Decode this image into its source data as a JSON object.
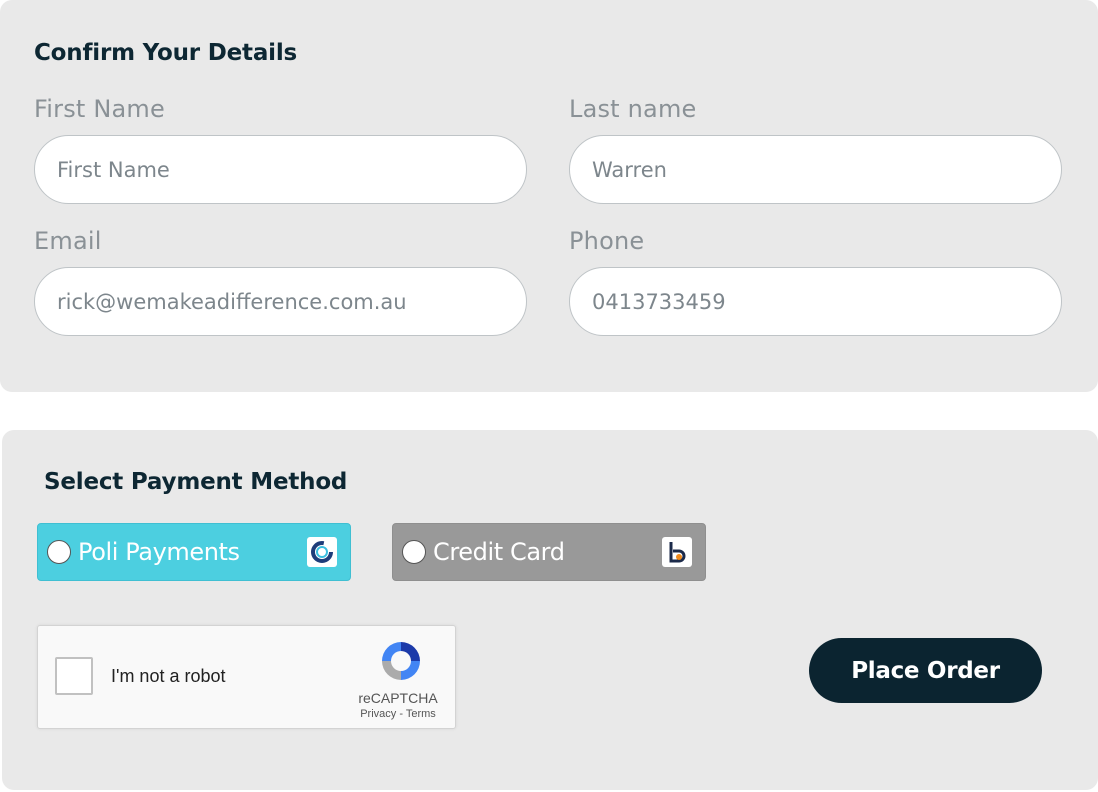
{
  "details": {
    "title": "Confirm Your Details",
    "first_name": {
      "label": "First Name",
      "placeholder": "First Name",
      "value": ""
    },
    "last_name": {
      "label": "Last name",
      "value": "Warren"
    },
    "email": {
      "label": "Email",
      "value": "rick@wemakeadifference.com.au"
    },
    "phone": {
      "label": "Phone",
      "value": "0413733459"
    }
  },
  "payment": {
    "title": "Select Payment Method",
    "options": [
      {
        "label": "Poli Payments",
        "color": "#4ccfe0",
        "icon": "poli-logo-icon"
      },
      {
        "label": "Credit Card",
        "color": "#999999",
        "icon": "bpoint-logo-icon"
      }
    ]
  },
  "recaptcha": {
    "label": "I'm not a robot",
    "brand": "reCAPTCHA",
    "privacy": "Privacy",
    "separator": " - ",
    "terms": "Terms"
  },
  "actions": {
    "place_order": "Place Order"
  },
  "colors": {
    "panel_bg": "#e9e9e9",
    "primary_dark": "#0b2430",
    "accent_cyan": "#4ccfe0"
  }
}
